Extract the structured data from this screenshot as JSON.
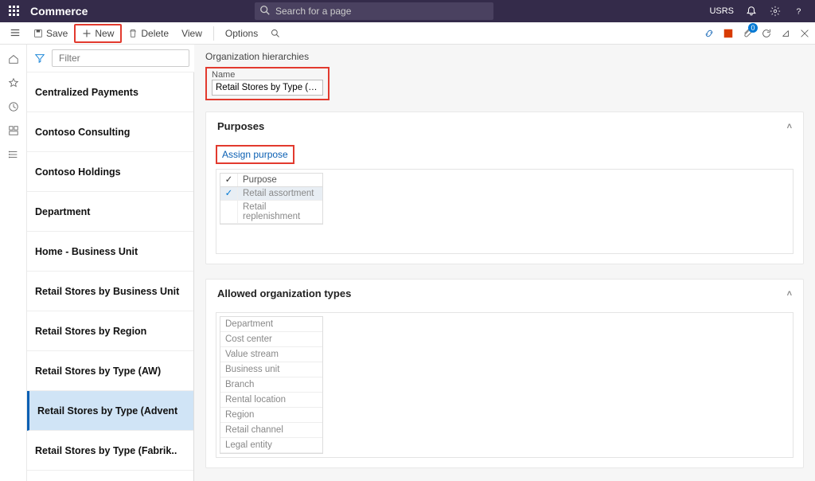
{
  "header": {
    "app_title": "Commerce",
    "search_placeholder": "Search for a page",
    "user_label": "USRS"
  },
  "commandbar": {
    "save_label": "Save",
    "new_label": "New",
    "delete_label": "Delete",
    "view_label": "View",
    "options_label": "Options"
  },
  "filter_placeholder": "Filter",
  "hierarchy_list": [
    {
      "label": "Centralized Payments"
    },
    {
      "label": "Contoso Consulting"
    },
    {
      "label": "Contoso Holdings"
    },
    {
      "label": "Department"
    },
    {
      "label": "Home - Business Unit"
    },
    {
      "label": "Retail Stores by Business Unit"
    },
    {
      "label": "Retail Stores by Region"
    },
    {
      "label": "Retail Stores by Type (AW)"
    },
    {
      "label": "Retail Stores by Type (Advent"
    },
    {
      "label": "Retail Stores by Type (Fabrik.."
    }
  ],
  "main": {
    "page_heading": "Organization hierarchies",
    "name_label": "Name",
    "name_value": "Retail Stores by Type (Adventur...",
    "purposes_heading": "Purposes",
    "assign_purpose_label": "Assign purpose",
    "purpose_column": "Purpose",
    "purposes": [
      {
        "label": "Retail assortment",
        "selected": true
      },
      {
        "label": "Retail replenishment",
        "selected": false
      }
    ],
    "allowed_types_heading": "Allowed organization types",
    "allowed_types": [
      "Department",
      "Cost center",
      "Value stream",
      "Business unit",
      "Branch",
      "Rental location",
      "Region",
      "Retail channel",
      "Legal entity"
    ]
  }
}
